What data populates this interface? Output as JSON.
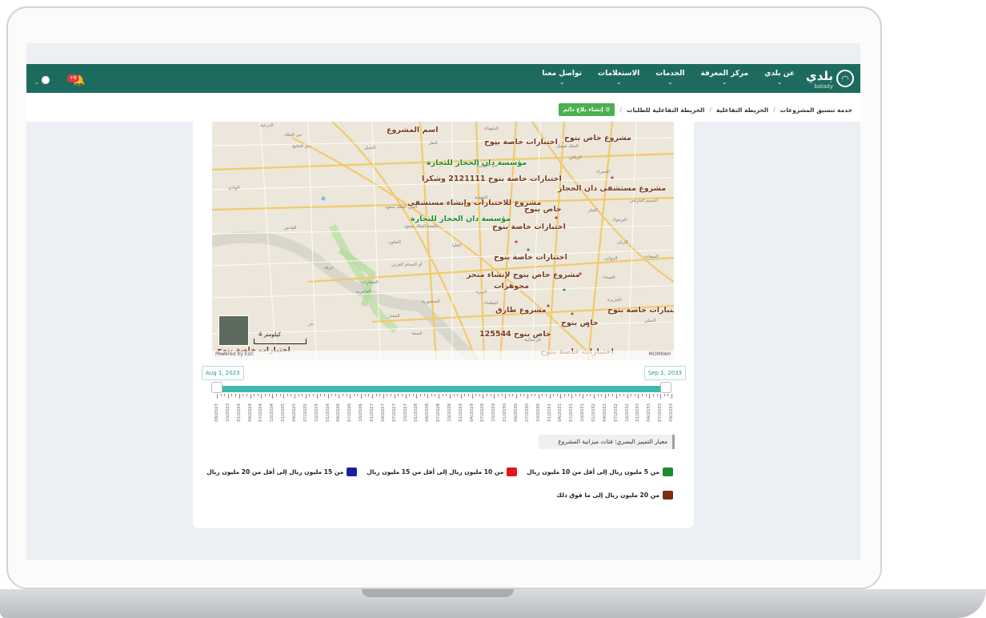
{
  "header": {
    "logo_text": "بلدي",
    "logo_sub": "balady",
    "nav": [
      {
        "label": "عن بلدي"
      },
      {
        "label": "مركز المعرفة"
      },
      {
        "label": "الخدمات"
      },
      {
        "label": "الاستعلامات"
      },
      {
        "label": "تواصل معنا"
      }
    ],
    "notification_badge": "+9"
  },
  "breadcrumb": {
    "items": [
      "خدمة تنسيق المشروعات",
      "الخريطة التفاعلية",
      "الخريطة التفاعلية للطلبات"
    ],
    "report_button": "إنشاء بلاغ دائم"
  },
  "map": {
    "labels": [
      {
        "text": "اسم المشروع",
        "color": "brown"
      },
      {
        "text": "اختبارات خاصة بنوح",
        "color": "brown"
      },
      {
        "text": "مشروع خاص بنوح",
        "color": "brown"
      },
      {
        "text": "مؤسسة دان الحجاز للتجارة",
        "color": "green"
      },
      {
        "text": "اختبارات خاصة بنوح 2121111 وشكرا",
        "color": "brown"
      },
      {
        "text": "مشروع مستشفى دان الحجاز",
        "color": "brown"
      },
      {
        "text": "مشروع للاختبارات وإنشاء مستشفى",
        "color": "brown"
      },
      {
        "text": "خاص بنوح",
        "color": "brown"
      },
      {
        "text": "مؤسسة دان الحجاز للتجارة",
        "color": "green"
      },
      {
        "text": "اختبارات خاصة بنوح",
        "color": "brown"
      },
      {
        "text": "اختبارات خاصة بنوح",
        "color": "brown"
      },
      {
        "text": "مشروع خاص بنوح لإنشاء متجر",
        "color": "brown"
      },
      {
        "text": "مجوهرات",
        "color": "brown"
      },
      {
        "text": "مشروع طارق",
        "color": "brown"
      },
      {
        "text": "اختبارات خاصة بنوح",
        "color": "brown"
      },
      {
        "text": "خاص بنوح",
        "color": "brown"
      },
      {
        "text": "خاص بنوح 125544",
        "color": "brown"
      },
      {
        "text": "اختبارات خاصة بنوح",
        "color": "brown"
      },
      {
        "text": "اختبارات خاصة بنوح",
        "color": "brown"
      }
    ],
    "pois": [
      "الدرعية",
      "حي الملك",
      "حي الخليج",
      "النفل",
      "الشهداء",
      "الملك فيصل",
      "الرياض",
      "حي العزيزية",
      "الحي الملك سعود",
      "جامعة الملك سعود",
      "المهدية",
      "عرقة",
      "الفاخرية",
      "السفارات",
      "الملز",
      "الروابي",
      "السعادة",
      "العليا",
      "الفيحاء",
      "المعذر",
      "اليرموك",
      "النسيم الشرقي",
      "الديرة",
      "البطحاء",
      "المنصورية",
      "بدر",
      "الحمراء",
      "الوادي",
      "التعاون",
      "النخيل",
      "الرحمانية",
      "الريان",
      "السلي",
      "القدس",
      "الشفا",
      "الجزيرة",
      "أم الحمام الغربي"
    ],
    "scale_text": "4 كيلومتر",
    "attribution_left": "Powered by Esri",
    "attribution_right": "MOMRAH"
  },
  "timeline": {
    "start_label": "Aug 1, 2023",
    "end_label": "Sep 1, 2033",
    "tick_labels": [
      "08/2023",
      "10/2023",
      "01/2024",
      "04/2024",
      "07/2024",
      "10/2024",
      "01/2025",
      "04/2025",
      "07/2025",
      "10/2025",
      "01/2026",
      "04/2026",
      "07/2026",
      "10/2026",
      "01/2027",
      "04/2027",
      "07/2027",
      "10/2027",
      "01/2028",
      "04/2028",
      "07/2028",
      "10/2028",
      "01/2029",
      "04/2029",
      "07/2029",
      "10/2029",
      "01/2030",
      "04/2030",
      "07/2030",
      "10/2030",
      "01/2031",
      "04/2031",
      "07/2031",
      "10/2031",
      "01/2032",
      "04/2032",
      "07/2032",
      "10/2032",
      "01/2033",
      "04/2033",
      "07/2033",
      "09/2033"
    ]
  },
  "legend": {
    "criteria_label": "معيار التمييز البصري: فئات ميزانية المشروع",
    "items": [
      {
        "label": "من 5 مليون ريال إلى أقل من 10 مليون ريال",
        "color": "#1f8a2c"
      },
      {
        "label": "من 10 مليون ريال إلى أقل من 15 مليون ريال",
        "color": "#e0161d"
      },
      {
        "label": "من 15 مليون ريال إلى أقل من 20 مليون ريال",
        "color": "#1b1fa0"
      },
      {
        "label": "من 20 مليون ريال إلى ما فوق ذلك",
        "color": "#7a2e12"
      }
    ]
  }
}
